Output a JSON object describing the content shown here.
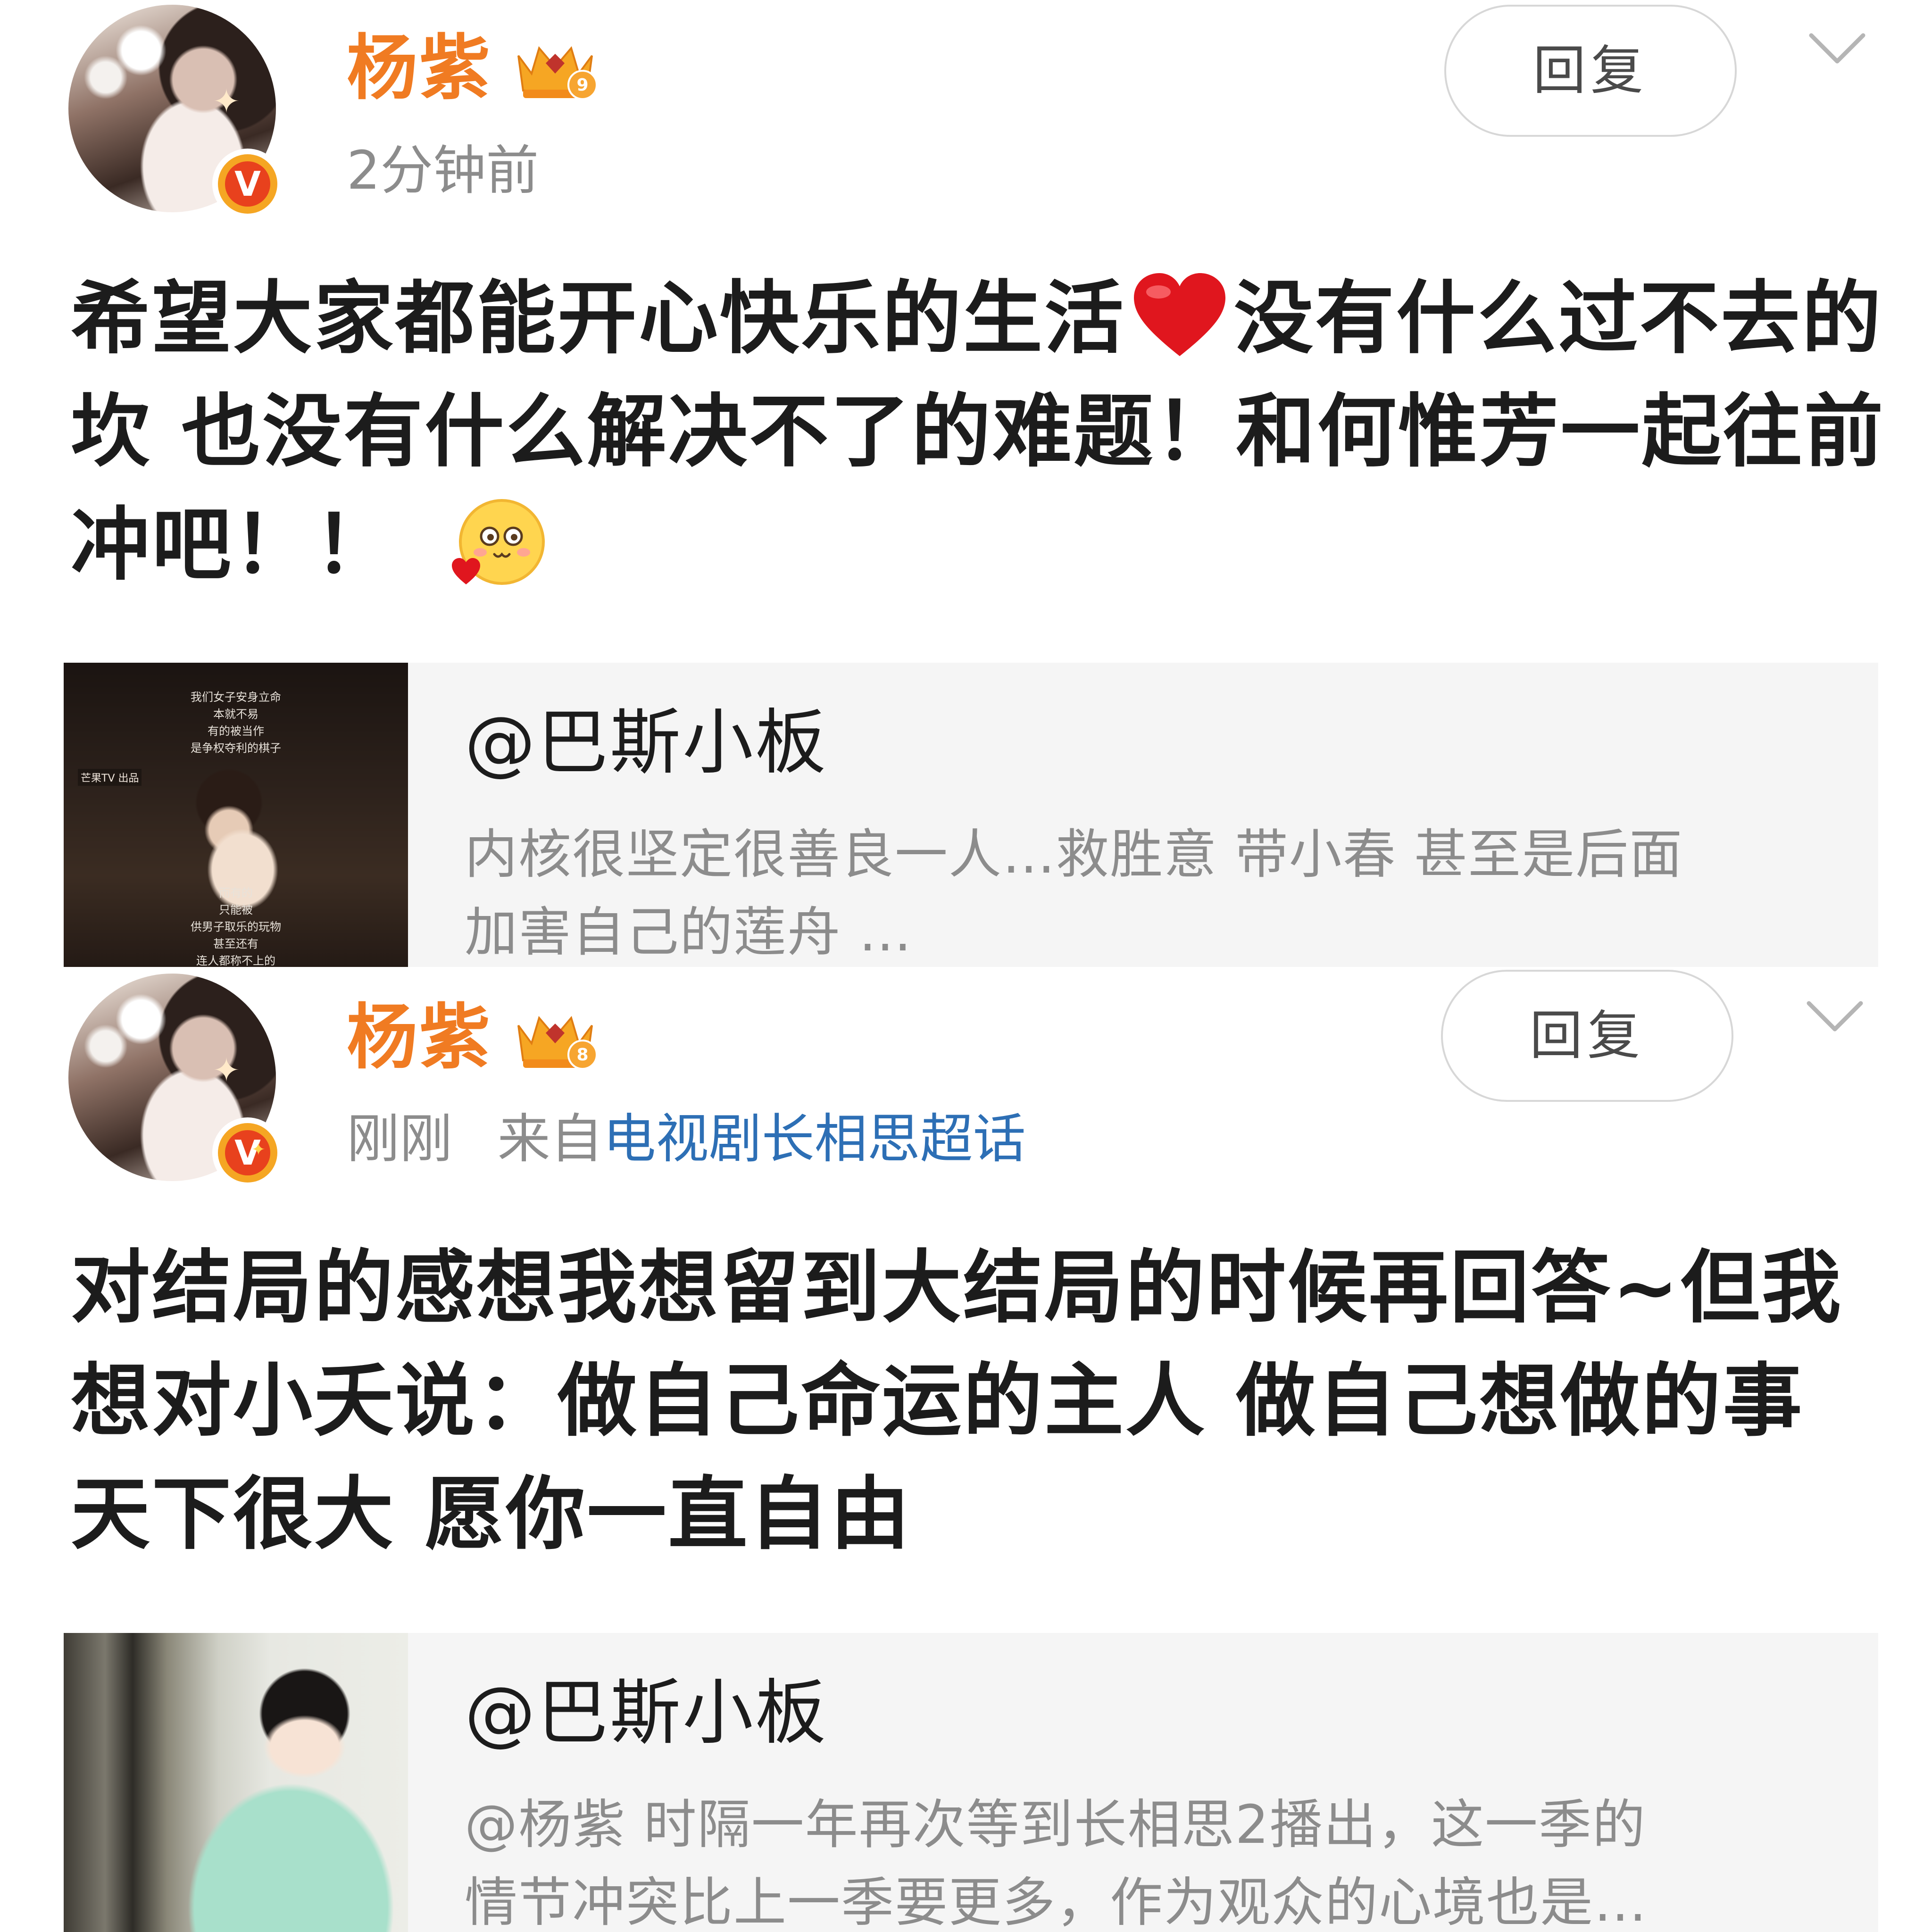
{
  "posts": [
    {
      "author_name": "杨紫",
      "badge_level": "9",
      "time": "2分钟前",
      "source_prefix": "",
      "source_link": "",
      "reply_label": "回复",
      "content_part1": "希望大家都能开心快乐的生活",
      "content_part2": "没有什么过不去的坎 也没有什么解决不了的难题！和何惟芳一起往前冲吧！！",
      "quote": {
        "author": "@巴斯小板",
        "excerpt": "内核很坚定很善良一人…救胜意 带小春 甚至是后面\n加害自己的莲舟 …",
        "thumb_caption_top": "我们女子安身立命\n本就不易\n有的被当作\n是争权夺利的棋子",
        "thumb_caption_bottom": "而有的\n只能被\n供男子取乐的玩物\n甚至还有\n连人都称不上的",
        "thumb_logo": "芒果TV 出品"
      }
    },
    {
      "author_name": "杨紫",
      "badge_level": "8",
      "time": "刚刚",
      "source_prefix": "来自",
      "source_link": "电视剧长相思超话",
      "reply_label": "回复",
      "content": "对结局的感想我想留到大结局的时候再回答~但我想对小夭说：做自己命运的主人 做自己想做的事 天下很大 愿你一直自由",
      "quote": {
        "author": "@巴斯小板",
        "excerpt": "@杨紫 时隔一年再次等到长相思2播出，这一季的\n情节冲突比上一季要更多，作为观众的心境也是…"
      }
    }
  ],
  "colors": {
    "name": "#f07b22",
    "link": "#2d6fb5",
    "meta": "#8c8c8c",
    "verified_badge": "#e8411d",
    "quote_bg": "#f5f5f5"
  },
  "icons": {
    "crown": "crown-level-badge-icon",
    "verified": "verified-v-icon",
    "chevron": "chevron-down-icon",
    "heart": "red-heart-emoji-icon",
    "face": "blush-heart-face-emoji-icon"
  }
}
